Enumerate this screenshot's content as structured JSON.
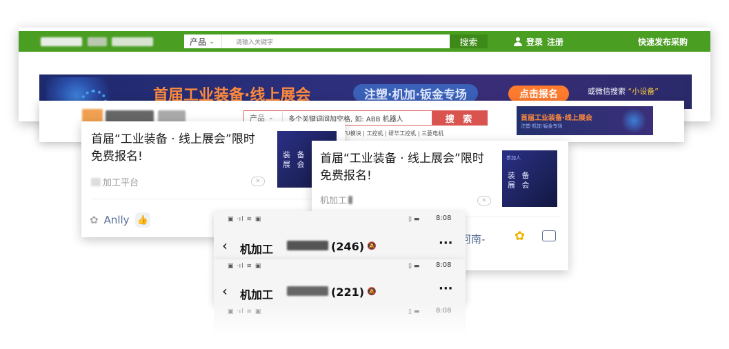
{
  "site_top": {
    "product_select": "产品",
    "search_placeholder": "请输入关键字",
    "search_button": "搜索",
    "login": "登录",
    "register": "注册",
    "publish_purchase": "快速发布采购",
    "banner": {
      "title": "首届工业装备·线上展会",
      "pill": "注塑·机加·钣金专场",
      "register_button": "点击报名",
      "wechat_text": "或微信搜索",
      "wechat_keyword": "“小设备”"
    },
    "colors": {
      "bar": "#4a9e22",
      "search_button": "#3d8a18"
    }
  },
  "site_second": {
    "product_select": "产品",
    "search_placeholder": "多个关键词间加空格, 如: ABB 机器人",
    "search_button": "搜 索",
    "hot_words": "TU模块 | 工控机 | 研华工控机 | 三菱电机",
    "banner_title": "首届工业装备·线上展会",
    "banner_sub": "注塑·机加·钣金专场",
    "colors": {
      "search_button": "#d9534f"
    }
  },
  "card_left": {
    "title": "首届“工业装备 · 线上展会”限时免费报名!",
    "source": "加工平台",
    "thumb_text": "装 备\n展 会",
    "author": "Anlly"
  },
  "card_right": {
    "title": "首届“工业装备 · 线上展会”限时免费报名!",
    "source": "机加工",
    "thumb_text": "装 备\n展 会",
    "thumb_small": "参加人",
    "partial_text": "河南-"
  },
  "phone_1": {
    "time": "8:08",
    "chat_name": "机加工",
    "member_count": "(246)"
  },
  "phone_2": {
    "time": "8:08",
    "chat_name": "机加工",
    "member_count": "(221)"
  },
  "phone_3": {
    "time": "8:08"
  }
}
